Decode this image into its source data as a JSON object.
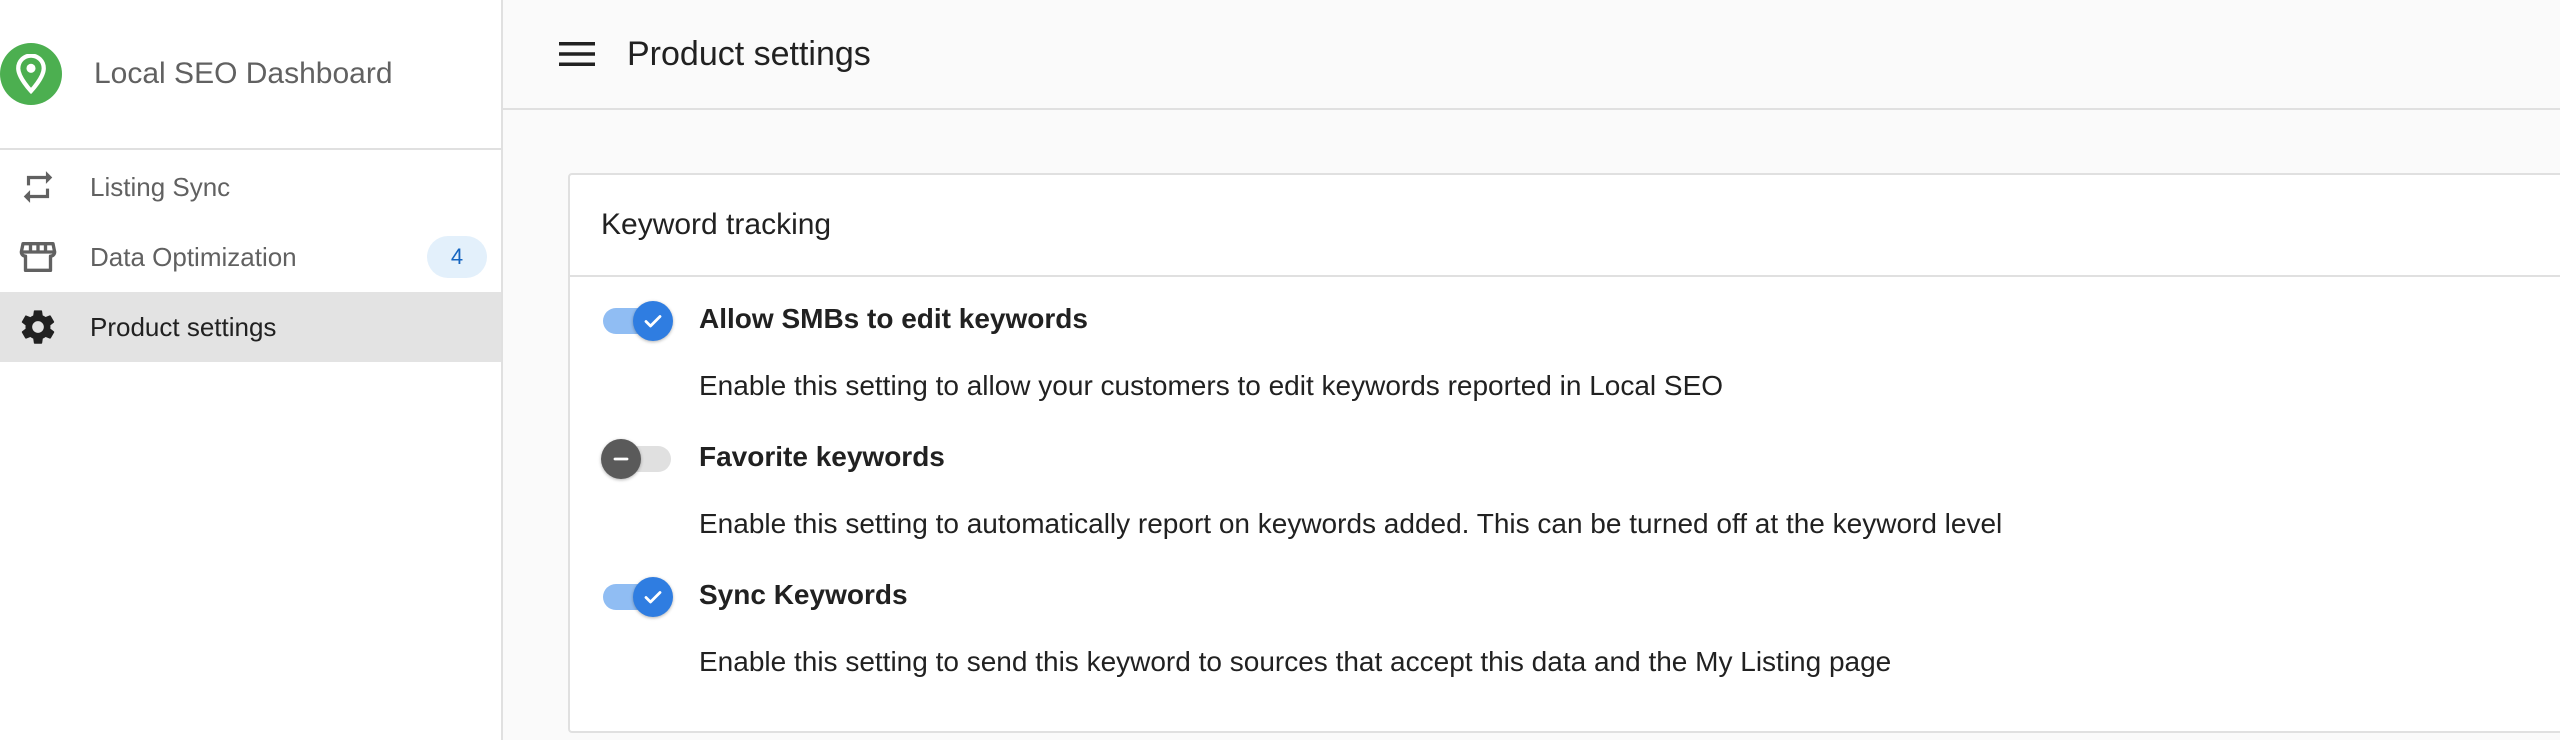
{
  "app": {
    "title": "Local SEO Dashboard",
    "brand_color": "#4caf50"
  },
  "sidebar": {
    "items": [
      {
        "label": "Listing Sync",
        "icon": "repeat-icon",
        "active": false
      },
      {
        "label": "Data Optimization",
        "icon": "storefront-icon",
        "badge": "4",
        "active": false
      },
      {
        "label": "Product settings",
        "icon": "gear-icon",
        "active": true
      }
    ]
  },
  "header": {
    "menu_icon": "hamburger-menu-icon",
    "title": "Product settings"
  },
  "card": {
    "title": "Keyword tracking",
    "settings": [
      {
        "label": "Allow SMBs to edit keywords",
        "description": "Enable this setting to allow your customers to edit keywords reported in Local SEO",
        "enabled": true
      },
      {
        "label": "Favorite keywords",
        "description": "Enable this setting to automatically report on keywords added. This can be turned off at the keyword level",
        "enabled": false
      },
      {
        "label": "Sync Keywords",
        "description": "Enable this setting to send this keyword to sources that accept this data and the My Listing page",
        "enabled": true
      }
    ]
  },
  "colors": {
    "accent": "#2f7de1",
    "accent_light": "#90bdf3",
    "active_nav_bg": "#e3e3e3",
    "badge_bg": "#e3f0fb"
  }
}
